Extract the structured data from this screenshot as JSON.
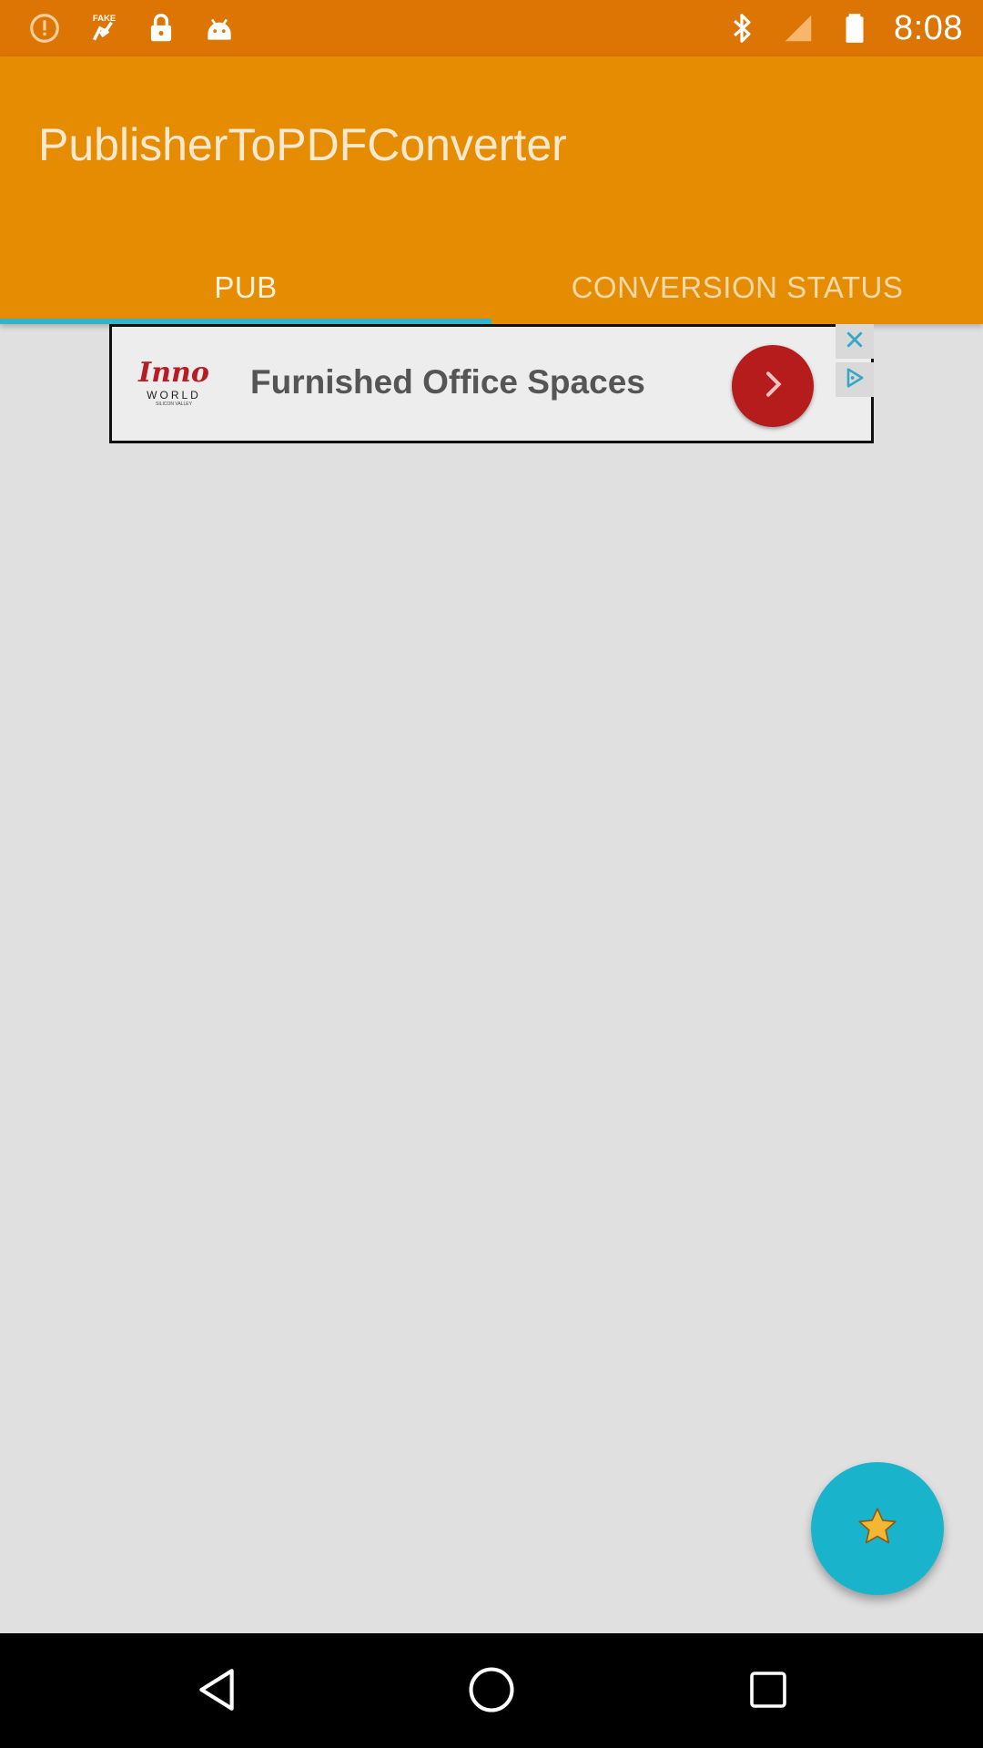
{
  "status_bar": {
    "time": "8:08",
    "left_icons": [
      "alert-circle-icon",
      "fake-gps-icon",
      "lock-icon",
      "android-icon"
    ],
    "right_icons": [
      "bluetooth-icon",
      "signal-off-icon",
      "battery-icon"
    ]
  },
  "app_bar": {
    "title": "PublisherToPDFConverter",
    "color": "#e58c02"
  },
  "tabs": [
    {
      "label": "PUB",
      "active": true
    },
    {
      "label": "CONVERSION STATUS",
      "active": false
    }
  ],
  "ad": {
    "brand": "Inno",
    "brand_sub": "WORLD",
    "brand_region": "SILICON VALLEY",
    "headline": "Furnished Office Spaces",
    "button_icon": "chevron-right-icon",
    "close_icon": "close-icon",
    "adchoices_icon": "adchoices-icon"
  },
  "fab": {
    "icon": "star-icon",
    "color": "#1ab3cc"
  },
  "nav_bar": {
    "buttons": [
      "back-icon",
      "home-icon",
      "recents-icon"
    ]
  }
}
